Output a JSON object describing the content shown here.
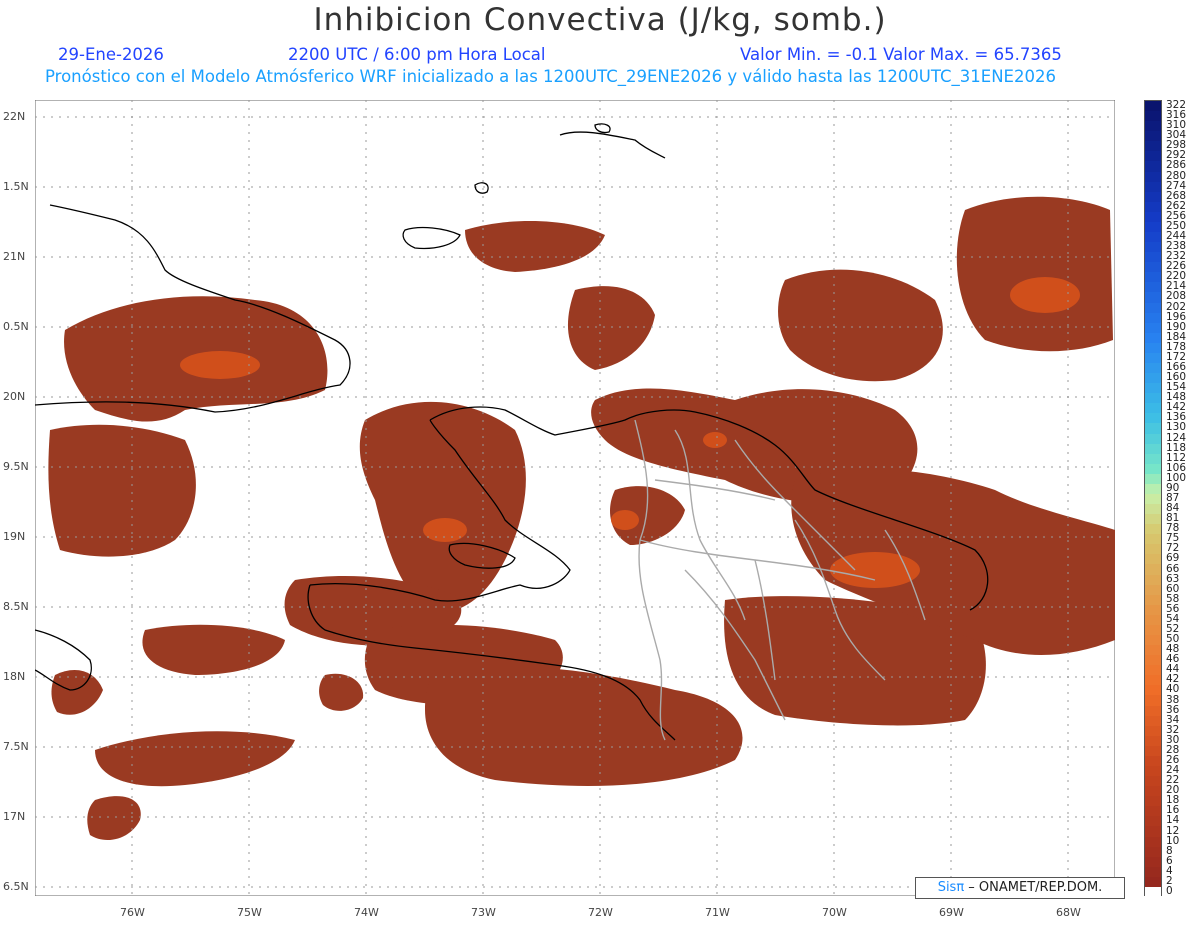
{
  "header": {
    "title": "Inhibicion Convectiva (J/kg, somb.)",
    "date": "29-Ene-2026",
    "time": "2200 UTC / 6:00 pm Hora Local",
    "minmax": "Valor Min. = -0.1  Valor Max. = 65.7365",
    "model_line": "Pronóstico con el Modelo Atmósferico WRF inicializado a las 1200UTC_29ENE2026 y válido hasta las  1200UTC_31ENE2026"
  },
  "map": {
    "lon_range": [
      -76.8,
      -67.6
    ],
    "lat_range": [
      16.5,
      22.0
    ],
    "lat_labels": [
      "22N",
      "1.5N",
      "21N",
      "0.5N",
      "20N",
      "9.5N",
      "19N",
      "8.5N",
      "18N",
      "7.5N",
      "17N",
      "6.5N"
    ],
    "lon_labels": [
      "76W",
      "75W",
      "74W",
      "73W",
      "72W",
      "71W",
      "70W",
      "69W",
      "68W"
    ],
    "shading_color": "#9a3a22",
    "shading_highlight": "#d9541a",
    "coastline_color": "#000000",
    "province_color": "#a9a9a9"
  },
  "colorbar": {
    "labels": [
      "322",
      "316",
      "310",
      "304",
      "298",
      "292",
      "286",
      "280",
      "274",
      "268",
      "262",
      "256",
      "250",
      "244",
      "238",
      "232",
      "226",
      "220",
      "214",
      "208",
      "202",
      "196",
      "190",
      "184",
      "178",
      "172",
      "166",
      "160",
      "154",
      "148",
      "142",
      "136",
      "130",
      "124",
      "118",
      "112",
      "106",
      "100",
      "90",
      "87",
      "84",
      "81",
      "78",
      "75",
      "72",
      "69",
      "66",
      "63",
      "60",
      "58",
      "56",
      "54",
      "52",
      "50",
      "48",
      "46",
      "44",
      "42",
      "40",
      "38",
      "36",
      "34",
      "32",
      "30",
      "28",
      "26",
      "24",
      "22",
      "20",
      "18",
      "16",
      "14",
      "12",
      "10",
      "8",
      "6",
      "4",
      "2",
      "0"
    ]
  },
  "credit": {
    "sis": "Sisπ",
    "rest": " – ONAMET/REP.DOM."
  }
}
